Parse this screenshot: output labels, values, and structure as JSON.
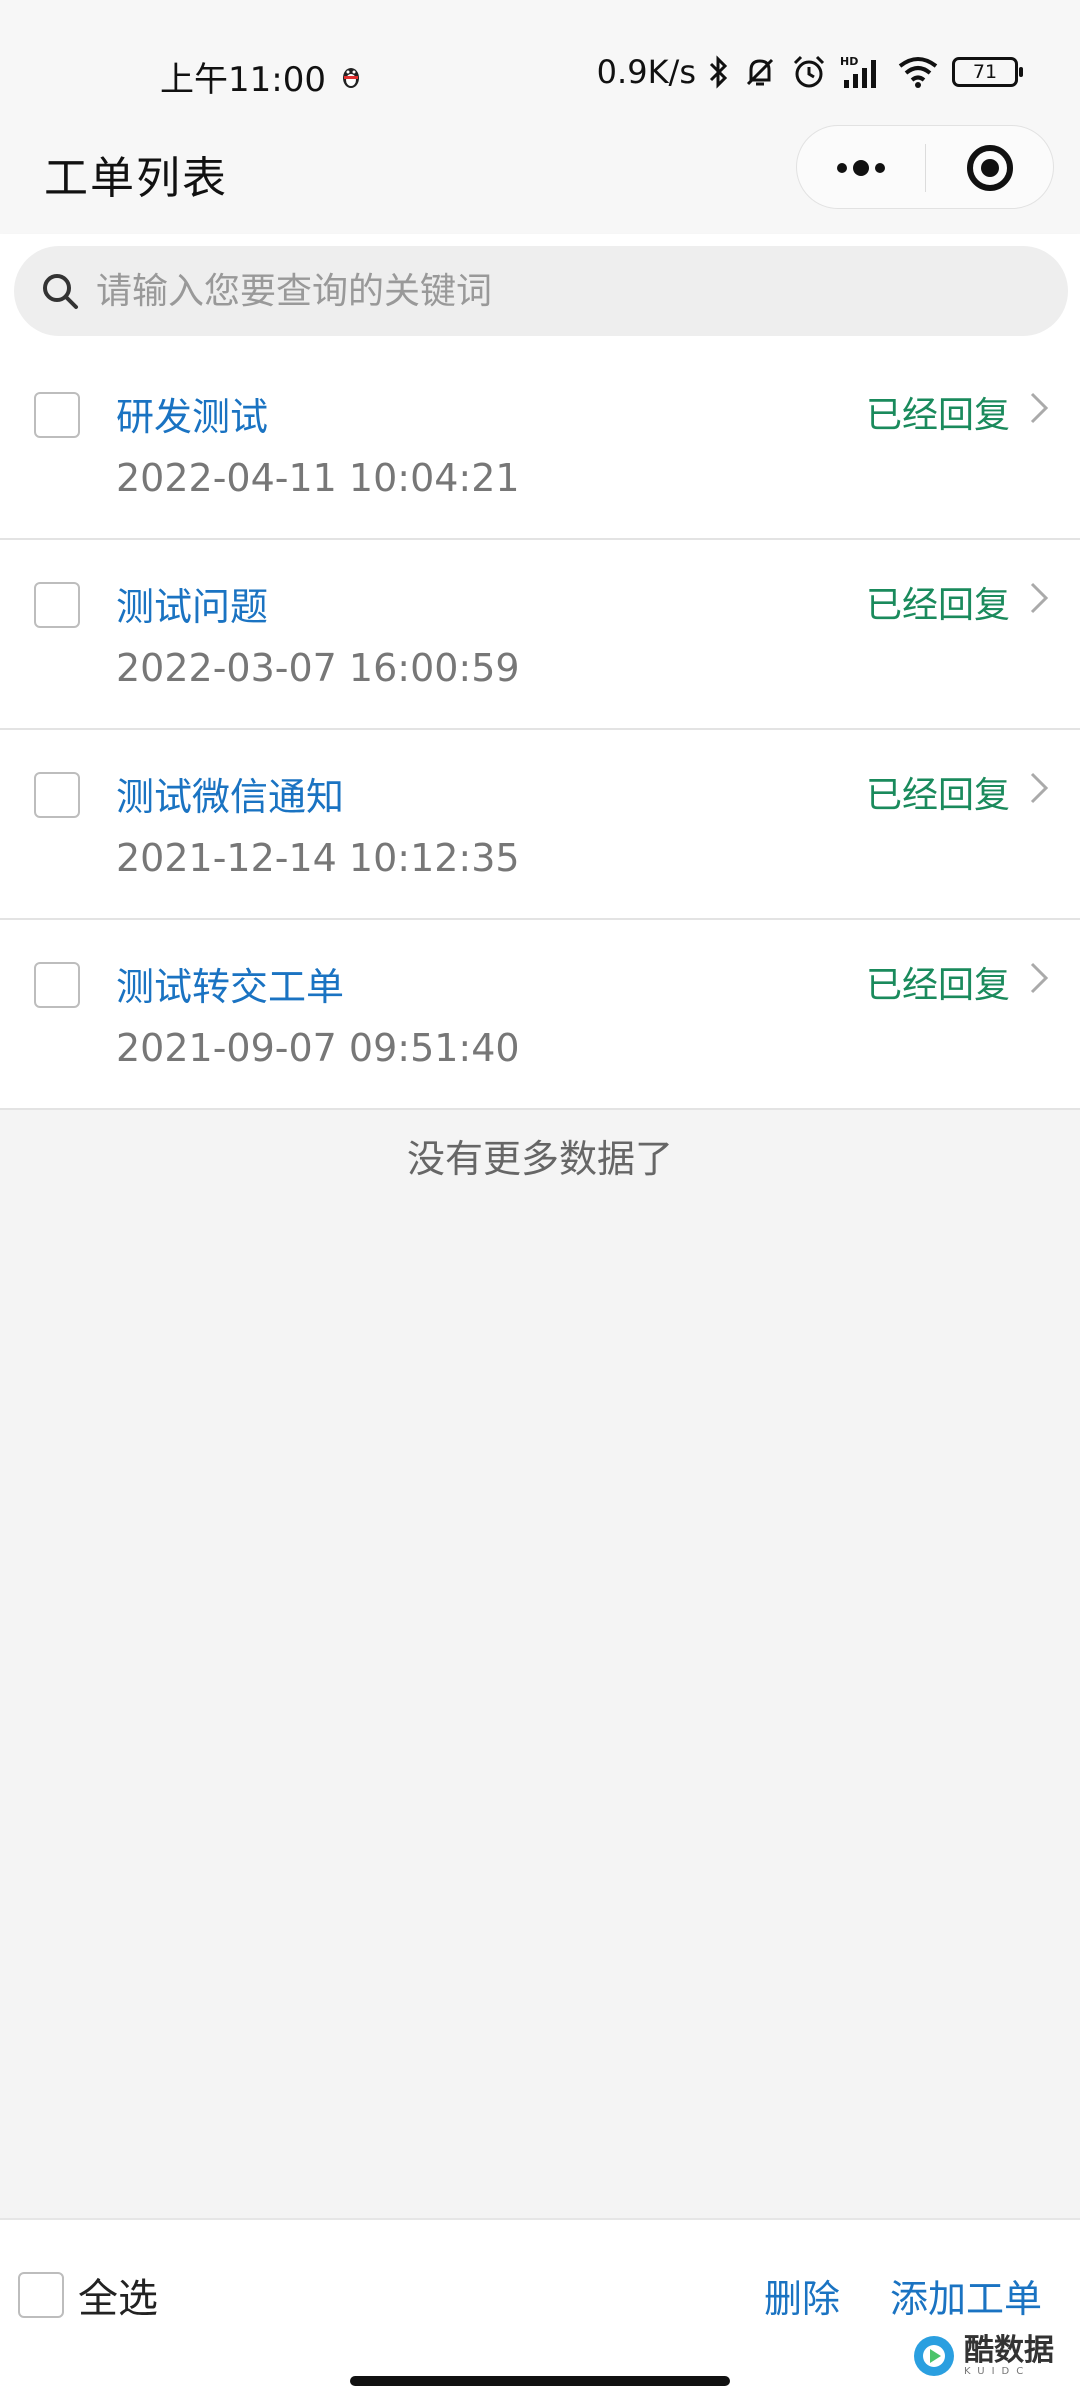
{
  "status_bar": {
    "time": "上午11:00",
    "speed": "0.9K/s",
    "battery": "71"
  },
  "header": {
    "title": "工单列表"
  },
  "search": {
    "placeholder": "请输入您要查询的关键词"
  },
  "tickets": [
    {
      "title": "研发测试",
      "date": "2022-04-11 10:04:21",
      "status": "已经回复"
    },
    {
      "title": "测试问题",
      "date": "2022-03-07 16:00:59",
      "status": "已经回复"
    },
    {
      "title": "测试微信通知",
      "date": "2021-12-14 10:12:35",
      "status": "已经回复"
    },
    {
      "title": "测试转交工单",
      "date": "2021-09-07 09:51:40",
      "status": "已经回复"
    }
  ],
  "list_footer": "没有更多数据了",
  "bottom_bar": {
    "select_all": "全选",
    "delete": "删除",
    "add": "添加工单"
  },
  "watermark": {
    "text": "酷数据",
    "sub": "KUIDC"
  },
  "colors": {
    "title_blue": "#1a73c2",
    "status_green": "#1a8a5c",
    "background": "#f4f4f4"
  }
}
